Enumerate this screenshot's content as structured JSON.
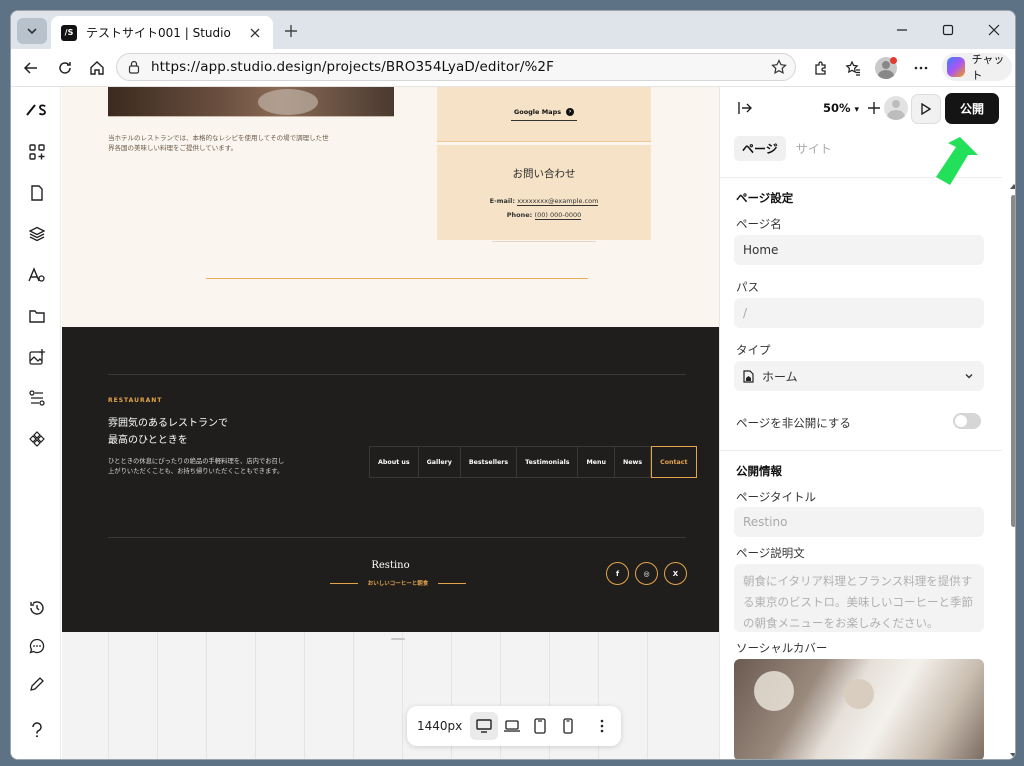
{
  "browser": {
    "tab_title": "テストサイト001 | Studio",
    "url": "https://app.studio.design/projects/BRO354LyaD/editor/%2F",
    "copilot_label": "チャット",
    "favicon_text": "/S"
  },
  "canvas": {
    "intro_text": "当ホテルのレストランでは、本格的なレシピを使用してその場で調理した世\n界各国の美味しい料理をご提供しています。",
    "maps_button": "Google Maps",
    "contact_heading": "お問い合わせ",
    "email_label": "E-mail: ",
    "email_value": "xxxxxxxx@example.com",
    "phone_label": "Phone: ",
    "phone_value": "(00) 000-0000",
    "footer": {
      "label": "RESTAURANT",
      "title": "雰囲気のあるレストランで\n最高のひとときを",
      "description": "ひとときの休息にぴったりの絶品の手軽料理を、店内でお召し\n上がりいただくことも、お持ち帰りいただくこともできます。",
      "nav": [
        "About us",
        "Gallery",
        "Bestsellers",
        "Testimonials",
        "Menu",
        "News",
        "Contact"
      ],
      "brand": "Restino",
      "tagline": "おいしいコーヒーと朝食",
      "social": [
        "f",
        "◎",
        "X"
      ]
    }
  },
  "device_bar": {
    "width_label": "1440px",
    "devices": [
      "desktop-icon",
      "laptop-icon",
      "tablet-icon",
      "mobile-icon"
    ]
  },
  "panel": {
    "zoom": "50%",
    "publish_label": "公開",
    "tabs": [
      "ページ",
      "サイト"
    ],
    "page_settings_heading": "ページ設定",
    "page_name_label": "ページ名",
    "page_name_value": "Home",
    "path_label": "パス",
    "path_placeholder": "/",
    "type_label": "タイプ",
    "type_value": "ホーム",
    "private_label": "ページを非公開にする",
    "private_enabled": false,
    "publish_info_heading": "公開情報",
    "page_title_label": "ページタイトル",
    "page_title_placeholder": "Restino",
    "description_label": "ページ説明文",
    "description_placeholder": "朝食にイタリア料理とフランス料理を提供する東京のビストロ。美味しいコーヒーと季節の朝食メニューをお楽しみください。",
    "social_cover_label": "ソーシャルカバー"
  },
  "colors": {
    "accent": "#e4a44a",
    "cream": "#faf6ef",
    "peach": "#f6e2c6",
    "footer_bg": "#1f1e1d",
    "publish_bg": "#141414",
    "annotation_arrow": "#22e05a"
  }
}
